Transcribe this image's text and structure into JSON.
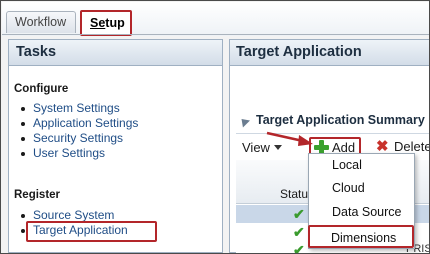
{
  "tabs": [
    {
      "label": "Workflow"
    },
    {
      "label_underlined": "Se",
      "label_rest": "tup"
    }
  ],
  "tasks": {
    "title": "Tasks",
    "configure": {
      "heading": "Configure",
      "links": [
        "System Settings",
        "Application Settings",
        "Security Settings",
        "User Settings"
      ]
    },
    "register": {
      "heading": "Register",
      "links": [
        "Source System",
        "Target Application"
      ]
    }
  },
  "target": {
    "title": "Target Application",
    "summary_title": "Target Application Summary",
    "toolbar": {
      "view_label": "View",
      "add_label": "Add",
      "delete_label": "Delete"
    },
    "grid": {
      "status_header": "Status",
      "row_partial_text": "PRISM - Scen"
    },
    "add_menu": [
      "Local",
      "Cloud",
      "Data Source",
      "Dimensions"
    ]
  },
  "colors": {
    "highlight": "#b3262a",
    "link": "#1f4d86",
    "check": "#3a9b2e"
  }
}
